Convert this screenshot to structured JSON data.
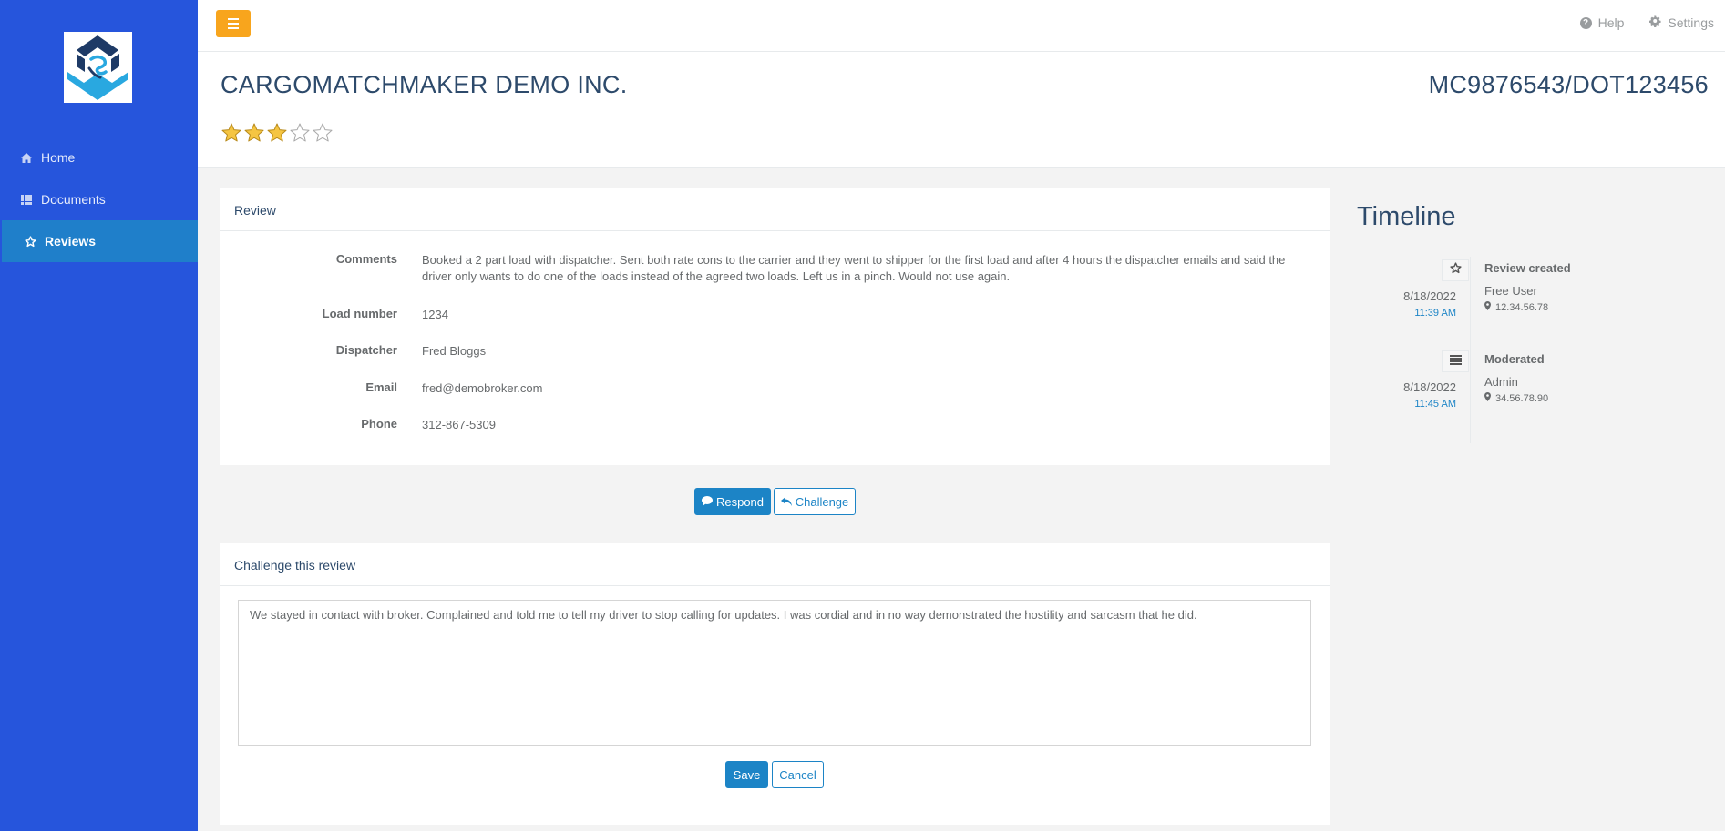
{
  "sidebar": {
    "items": [
      {
        "label": "Home",
        "icon": "home-icon"
      },
      {
        "label": "Documents",
        "icon": "list-icon"
      },
      {
        "label": "Reviews",
        "icon": "star-icon",
        "active": true
      }
    ]
  },
  "topbar": {
    "help_label": "Help",
    "settings_label": "Settings"
  },
  "header": {
    "company_name": "CARGOMATCHMAKER DEMO INC.",
    "mc_dot": "MC9876543/DOT123456",
    "rating": 3,
    "rating_max": 5
  },
  "review": {
    "title": "Review",
    "fields": {
      "comments_label": "Comments",
      "comments_value": "Booked a 2 part load with dispatcher. Sent both rate cons to the carrier and they went to shipper for the first load and after 4 hours the dispatcher emails and said the driver only wants to do one of the loads instead of the agreed two loads. Left us in a pinch. Would not use again.",
      "load_label": "Load number",
      "load_value": "1234",
      "dispatcher_label": "Dispatcher",
      "dispatcher_value": "Fred Bloggs",
      "email_label": "Email",
      "email_value": "fred@demobroker.com",
      "phone_label": "Phone",
      "phone_value": "312-867-5309"
    }
  },
  "actions": {
    "respond_label": "Respond",
    "challenge_label": "Challenge"
  },
  "challenge": {
    "title": "Challenge this review",
    "text": "We stayed in contact with broker. Complained and told me to tell my driver to stop calling for updates. I was cordial and in no way demonstrated the hostility and sarcasm that he did.",
    "save_label": "Save",
    "cancel_label": "Cancel"
  },
  "timeline": {
    "title": "Timeline",
    "events": [
      {
        "date": "8/18/2022",
        "time": "11:39 AM",
        "heading": "Review created",
        "user": "Free User",
        "ip": "12.34.56.78",
        "icon": "star-icon"
      },
      {
        "date": "8/18/2022",
        "time": "11:45 AM",
        "heading": "Moderated",
        "user": "Admin",
        "ip": "34.56.78.90",
        "icon": "list-icon"
      }
    ]
  },
  "colors": {
    "sidebar": "#2655dc",
    "sidebar_active": "#1f7fca",
    "primary": "#1c84c6",
    "accent": "#f8a51d",
    "heading_text": "#2d4a6b"
  }
}
